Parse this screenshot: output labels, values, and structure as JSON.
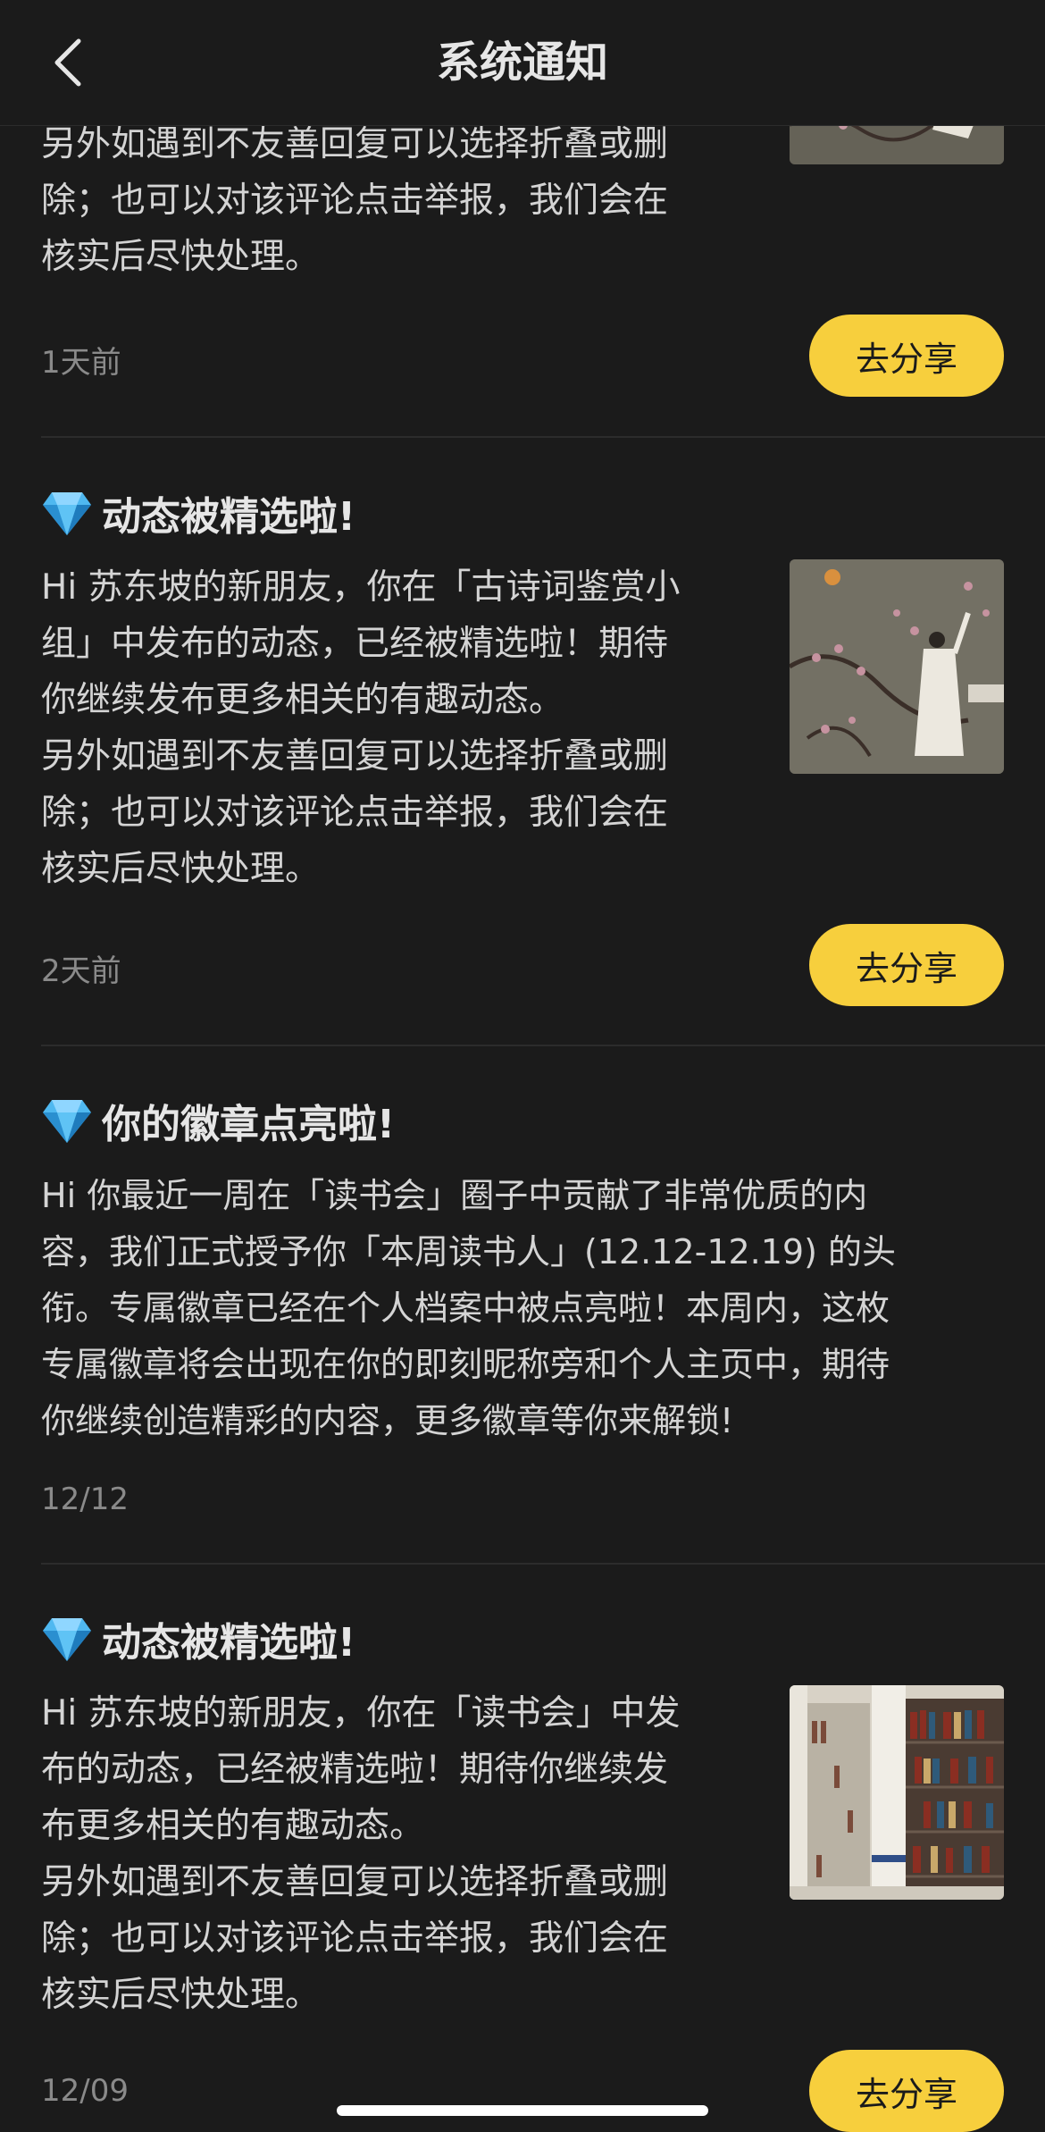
{
  "header": {
    "title": "系统通知"
  },
  "cards": [
    {
      "paragraph2": [
        "另外如遇到不友善回复可以选择折叠或删",
        "除；也可以对该评论点击举报，我们会在",
        "核实后尽快处理。"
      ],
      "time": "1天前",
      "share_label": "去分享"
    },
    {
      "title": "动态被精选啦!",
      "paragraph1": [
        "Hi 苏东坡的新朋友，你在「古诗词鉴赏小",
        "组」中发布的动态，已经被精选啦！期待",
        "你继续发布更多相关的有趣动态。"
      ],
      "paragraph2": [
        "另外如遇到不友善回复可以选择折叠或删",
        "除；也可以对该评论点击举报，我们会在",
        "核实后尽快处理。"
      ],
      "time": "2天前",
      "share_label": "去分享",
      "image": "chinese-painting-scholar"
    },
    {
      "title": "你的徽章点亮啦!",
      "paragraph1": [
        "Hi 你最近一周在「读书会」圈子中贡献了非常优质的内",
        "容，我们正式授予你「本周读书人」(12.12-12.19) 的头",
        "衔。专属徽章已经在个人档案中被点亮啦！本周内，这枚",
        "专属徽章将会出现在你的即刻昵称旁和个人主页中，期待",
        "你继续创造精彩的内容，更多徽章等你来解锁!"
      ],
      "time": "12/12"
    },
    {
      "title": "动态被精选啦!",
      "paragraph1": [
        "Hi 苏东坡的新朋友，你在「读书会」中发",
        "布的动态，已经被精选啦！期待你继续发",
        "布更多相关的有趣动态。"
      ],
      "paragraph2": [
        "另外如遇到不友善回复可以选择折叠或删",
        "除；也可以对该评论点击举报，我们会在",
        "核实后尽快处理。"
      ],
      "time": "12/09",
      "share_label": "去分享",
      "image": "library-bookshelves"
    }
  ],
  "colors": {
    "background": "#1b1b1b",
    "accent": "#f7cf3d",
    "text": "#d4d4d4",
    "muted": "#8a8a8a"
  },
  "icons": {
    "back": "chevron-left-icon",
    "gem": "diamond-gem-icon"
  }
}
